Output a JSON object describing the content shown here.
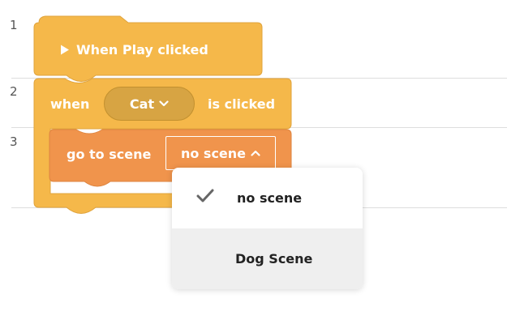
{
  "editor": {
    "line_numbers": [
      "1",
      "2",
      "3"
    ]
  },
  "blocks": {
    "event_play": {
      "play_icon": "play-triangle-icon",
      "label": "When Play clicked",
      "color": "#f5b84a"
    },
    "event_sprite": {
      "prefix": "when",
      "sprite_value": "Cat",
      "suffix": "is clicked",
      "color": "#f5b84a",
      "pill_color": "#d7a443"
    },
    "go_to_scene": {
      "label": "go to scene",
      "scene_value": "no scene",
      "color": "#f0944c"
    }
  },
  "dropdown": {
    "options": [
      {
        "label": "no scene",
        "selected": true,
        "icon": "check-icon"
      },
      {
        "label": "Dog Scene",
        "selected": false
      }
    ]
  }
}
